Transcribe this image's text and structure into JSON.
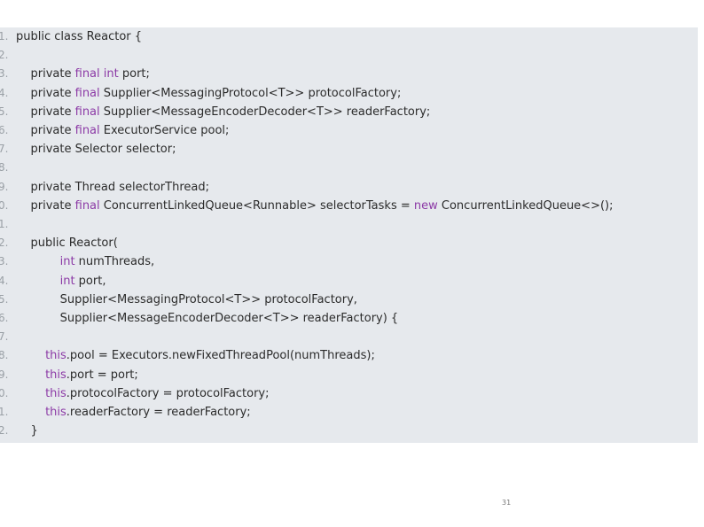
{
  "code": {
    "lines": [
      {
        "number": "1.",
        "tokens": [
          {
            "t": "public class",
            "k": "plain"
          },
          {
            "t": " Reactor {",
            "k": "plain"
          }
        ]
      },
      {
        "number": "2.",
        "tokens": []
      },
      {
        "number": "3.",
        "tokens": [
          {
            "t": "    private ",
            "k": "plain"
          },
          {
            "t": "final",
            "k": "keyword"
          },
          {
            "t": " ",
            "k": "plain"
          },
          {
            "t": "int",
            "k": "keyword"
          },
          {
            "t": " port;",
            "k": "plain"
          }
        ]
      },
      {
        "number": "4.",
        "tokens": [
          {
            "t": "    private ",
            "k": "plain"
          },
          {
            "t": "final",
            "k": "keyword"
          },
          {
            "t": " Supplier<MessagingProtocol<T>> protocolFactory;",
            "k": "plain"
          }
        ]
      },
      {
        "number": "5.",
        "tokens": [
          {
            "t": "    private ",
            "k": "plain"
          },
          {
            "t": "final",
            "k": "keyword"
          },
          {
            "t": " Supplier<MessageEncoderDecoder<T>> readerFactory;",
            "k": "plain"
          }
        ]
      },
      {
        "number": "6.",
        "tokens": [
          {
            "t": "    private ",
            "k": "plain"
          },
          {
            "t": "final",
            "k": "keyword"
          },
          {
            "t": " ExecutorService pool;",
            "k": "plain"
          }
        ]
      },
      {
        "number": "7.",
        "tokens": [
          {
            "t": "    private Selector selector;",
            "k": "plain"
          }
        ]
      },
      {
        "number": "8.",
        "tokens": []
      },
      {
        "number": "9.",
        "tokens": [
          {
            "t": "    private Thread selectorThread;",
            "k": "plain"
          }
        ]
      },
      {
        "number": "0.",
        "tokens": [
          {
            "t": "    private ",
            "k": "plain"
          },
          {
            "t": "final",
            "k": "keyword"
          },
          {
            "t": " ConcurrentLinkedQueue<Runnable> selectorTasks = ",
            "k": "plain"
          },
          {
            "t": "new",
            "k": "keyword"
          },
          {
            "t": " ConcurrentLinkedQueue<>();",
            "k": "plain"
          }
        ]
      },
      {
        "number": "1.",
        "tokens": []
      },
      {
        "number": "2.",
        "tokens": [
          {
            "t": "    public Reactor(",
            "k": "plain"
          }
        ]
      },
      {
        "number": "3.",
        "tokens": [
          {
            "t": "            ",
            "k": "plain"
          },
          {
            "t": "int",
            "k": "keyword"
          },
          {
            "t": " numThreads,",
            "k": "plain"
          }
        ]
      },
      {
        "number": "4.",
        "tokens": [
          {
            "t": "            ",
            "k": "plain"
          },
          {
            "t": "int",
            "k": "keyword"
          },
          {
            "t": " port,",
            "k": "plain"
          }
        ]
      },
      {
        "number": "5.",
        "tokens": [
          {
            "t": "            Supplier<MessagingProtocol<T>> protocolFactory,",
            "k": "plain"
          }
        ]
      },
      {
        "number": "6.",
        "tokens": [
          {
            "t": "            Supplier<MessageEncoderDecoder<T>> readerFactory) {",
            "k": "plain"
          }
        ]
      },
      {
        "number": "7.",
        "tokens": []
      },
      {
        "number": "8.",
        "tokens": [
          {
            "t": "        ",
            "k": "plain"
          },
          {
            "t": "this",
            "k": "keyword"
          },
          {
            "t": ".pool = Executors.newFixedThreadPool(numThreads);",
            "k": "plain"
          }
        ]
      },
      {
        "number": "9.",
        "tokens": [
          {
            "t": "        ",
            "k": "plain"
          },
          {
            "t": "this",
            "k": "keyword"
          },
          {
            "t": ".port = port;",
            "k": "plain"
          }
        ]
      },
      {
        "number": "0.",
        "tokens": [
          {
            "t": "        ",
            "k": "plain"
          },
          {
            "t": "this",
            "k": "keyword"
          },
          {
            "t": ".protocolFactory = protocolFactory;",
            "k": "plain"
          }
        ]
      },
      {
        "number": "1.",
        "tokens": [
          {
            "t": "        ",
            "k": "plain"
          },
          {
            "t": "this",
            "k": "keyword"
          },
          {
            "t": ".readerFactory = readerFactory;",
            "k": "plain"
          }
        ]
      },
      {
        "number": "2.",
        "tokens": [
          {
            "t": "    }",
            "k": "plain"
          }
        ]
      }
    ]
  },
  "footer": {
    "page_number": "31"
  },
  "colors": {
    "code_background": "#e6e9ed",
    "keyword": "#8c3aa6",
    "plain": "#2b2b2b",
    "line_number": "#9aa0a6"
  }
}
